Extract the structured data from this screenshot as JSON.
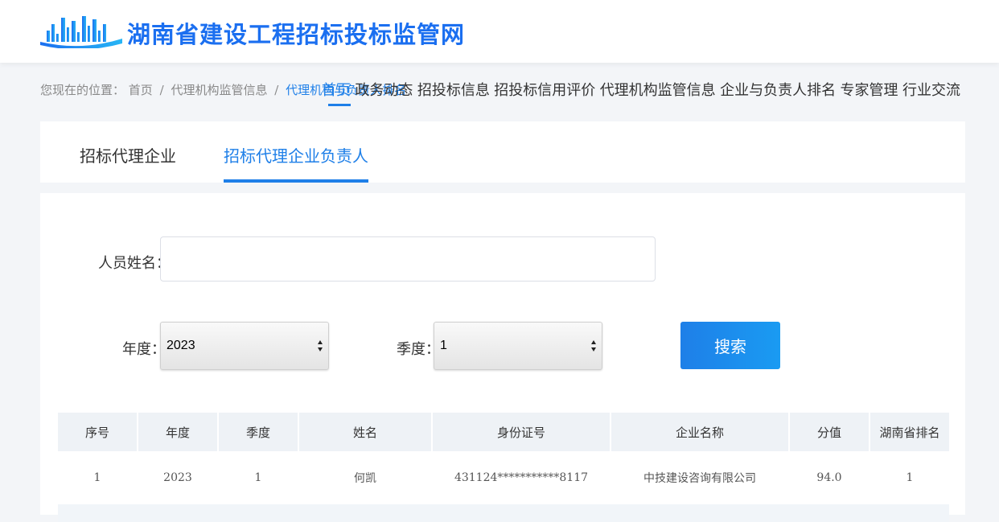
{
  "site": {
    "title": "湖南省建设工程招标投标监管网",
    "accent": "#1e7fe8"
  },
  "breadcrumb": {
    "prefix": "您现在的位置：",
    "items": [
      "首页",
      "代理机构监管信息",
      "代理机构与负责人排名"
    ],
    "separator": "/"
  },
  "nav": {
    "items": [
      "首页",
      "政务动态",
      "招投标信息",
      "招投标信用评价",
      "代理机构监管信息",
      "企业与负责人排名",
      "专家管理",
      "行业交流"
    ],
    "active_index": 0
  },
  "tabs": {
    "items": [
      "招标代理企业",
      "招标代理企业负责人"
    ],
    "active_index": 1
  },
  "form": {
    "name_label": "人员姓名：",
    "name_value": "",
    "name_placeholder": "",
    "year_label": "年度：",
    "year_value": "2023",
    "quarter_label": "季度：",
    "quarter_value": "1",
    "search_label": "搜索"
  },
  "table": {
    "headers": [
      "序号",
      "年度",
      "季度",
      "姓名",
      "身份证号",
      "企业名称",
      "分值",
      "湖南省排名"
    ],
    "rows": [
      [
        "1",
        "2023",
        "1",
        "何凯",
        "431124***********8117",
        "中技建设咨询有限公司",
        "94.0",
        "1"
      ]
    ]
  }
}
